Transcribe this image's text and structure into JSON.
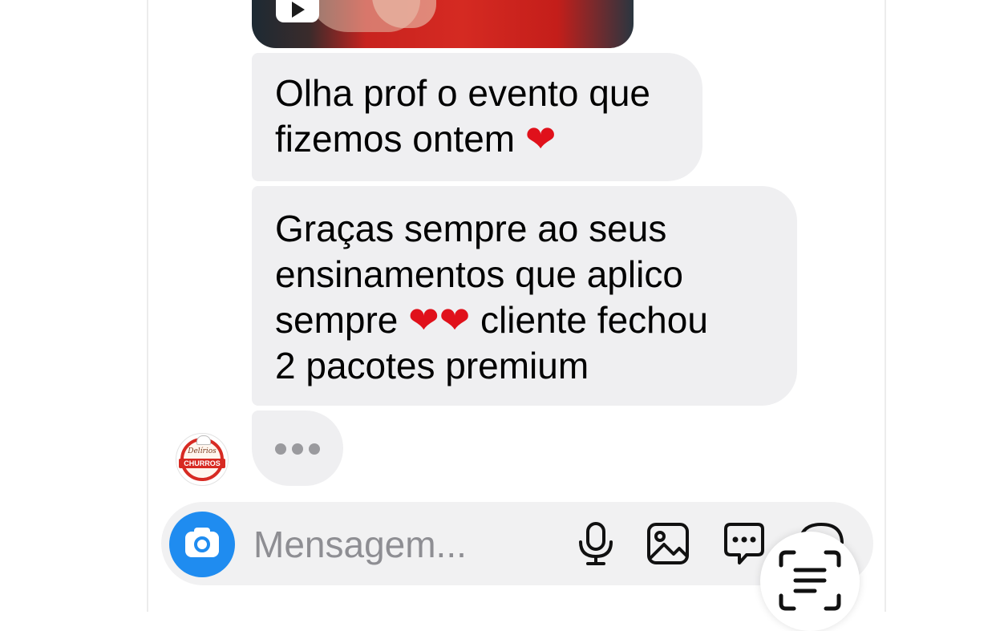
{
  "conversation": {
    "messages": [
      {
        "lines": [
          {
            "text": "Olha prof o evento que",
            "emoji": ""
          },
          {
            "text": "fizemos ontem ",
            "emoji": "❤"
          }
        ]
      },
      {
        "lines": [
          {
            "text": "Graças sempre ao seus",
            "emoji": ""
          },
          {
            "text": "ensinamentos que aplico",
            "emoji": ""
          },
          {
            "text": "sempre ",
            "emoji": "❤",
            "emoji2": "❤",
            "after": " cliente fechou"
          },
          {
            "text": "2 pacotes premium",
            "emoji": ""
          }
        ]
      }
    ],
    "avatar": {
      "top_text": "Delírios",
      "banner_text": "CHURROS"
    }
  },
  "composer": {
    "placeholder": "Mensagem...",
    "icons": [
      "camera-icon",
      "microphone-icon",
      "gallery-icon",
      "sticker-icon",
      "more-icon",
      "text-scan-icon"
    ]
  },
  "colors": {
    "bubble": "#efeff1",
    "accent": "#1f8cf0",
    "heart": "#e0111b"
  }
}
